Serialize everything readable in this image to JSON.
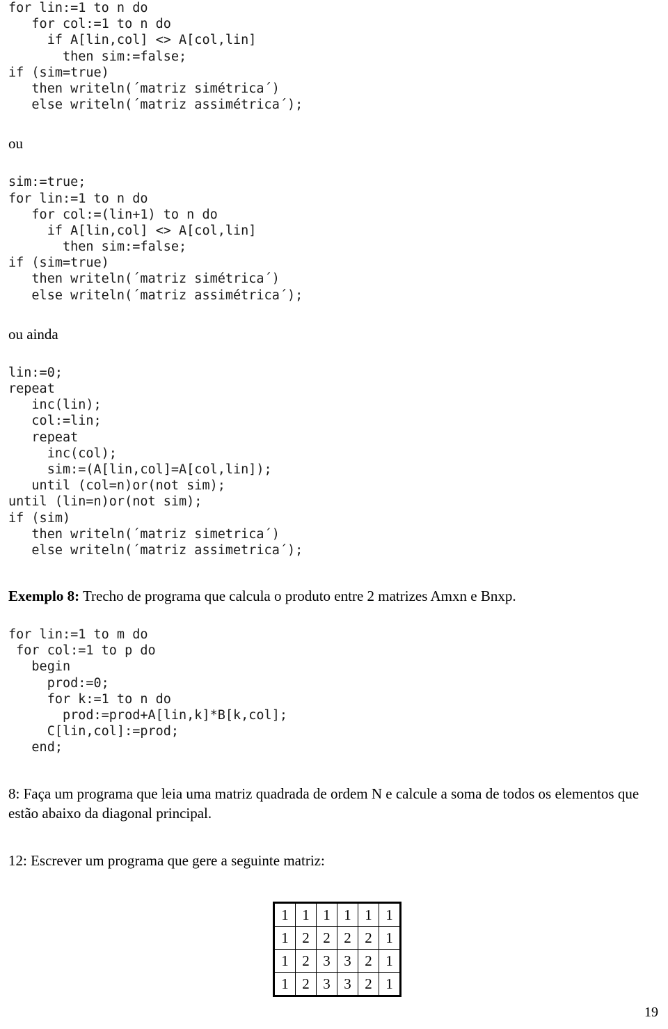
{
  "page": {
    "number": "19"
  },
  "blocks": {
    "code_symmetric_full": [
      "for lin:=1 to n do",
      "   for col:=1 to n do",
      "     if A[lin,col] <> A[col,lin]",
      "       then sim:=false;",
      "if (sim=true)",
      "   then writeln(´matriz simétrica´)",
      "   else writeln(´matriz assimétrica´);"
    ],
    "label_ou": "ou",
    "code_symmetric_upper": [
      "sim:=true;",
      "for lin:=1 to n do",
      "   for col:=(lin+1) to n do",
      "     if A[lin,col] <> A[col,lin]",
      "       then sim:=false;",
      "if (sim=true)",
      "   then writeln(´matriz simétrica´)",
      "   else writeln(´matriz assimétrica´);"
    ],
    "label_ou_ainda": "ou ainda",
    "code_symmetric_repeat": [
      "lin:=0;",
      "repeat",
      "   inc(lin);",
      "   col:=lin;",
      "   repeat",
      "     inc(col);",
      "     sim:=(A[lin,col]=A[col,lin]);",
      "   until (col=n)or(not sim);",
      "until (lin=n)or(not sim);",
      "if (sim)",
      "   then writeln(´matriz simetrica´)",
      "   else writeln(´matriz assimetrica´);"
    ],
    "exemplo8": {
      "label": "Exemplo 8:",
      "text": " Trecho de programa que calcula o produto entre 2 matrizes Amxn e Bnxp."
    },
    "code_product": [
      "for lin:=1 to m do",
      " for col:=1 to p do",
      "   begin",
      "     prod:=0;",
      "     for k:=1 to n do",
      "       prod:=prod+A[lin,k]*B[k,col];",
      "     C[lin,col]:=prod;",
      "   end;"
    ],
    "exercise_8": "8: Faça um programa que leia uma matriz quadrada de ordem N e calcule a soma de todos os elementos que estão abaixo da diagonal principal.",
    "exercise_12": "12: Escrever um programa que gere a seguinte matriz:"
  },
  "matrix": {
    "rows": [
      [
        "1",
        "1",
        "1",
        "1",
        "1",
        "1"
      ],
      [
        "1",
        "2",
        "2",
        "2",
        "2",
        "1"
      ],
      [
        "1",
        "2",
        "3",
        "3",
        "2",
        "1"
      ],
      [
        "1",
        "2",
        "3",
        "3",
        "2",
        "1"
      ]
    ]
  }
}
